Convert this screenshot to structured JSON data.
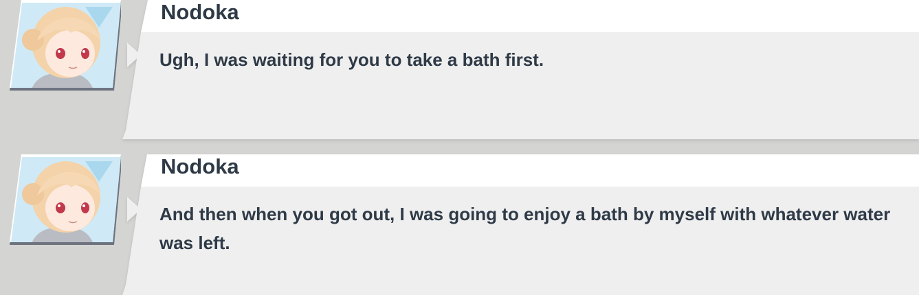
{
  "messages": [
    {
      "speaker": "Nodoka",
      "text": "Ugh, I was waiting for you to take a bath first."
    },
    {
      "speaker": "Nodoka",
      "text": "And then when you got out, I was going to enjoy a bath by myself with whatever water was left."
    }
  ],
  "colors": {
    "background": "#d4d4d2",
    "name_bar": "#ffffff",
    "message_panel": "#efefef",
    "text": "#2f3a47",
    "avatar_frame": "#ffffff",
    "avatar_bg": "#cfeaf6"
  },
  "avatar_icon": "nodoka-portrait-icon"
}
